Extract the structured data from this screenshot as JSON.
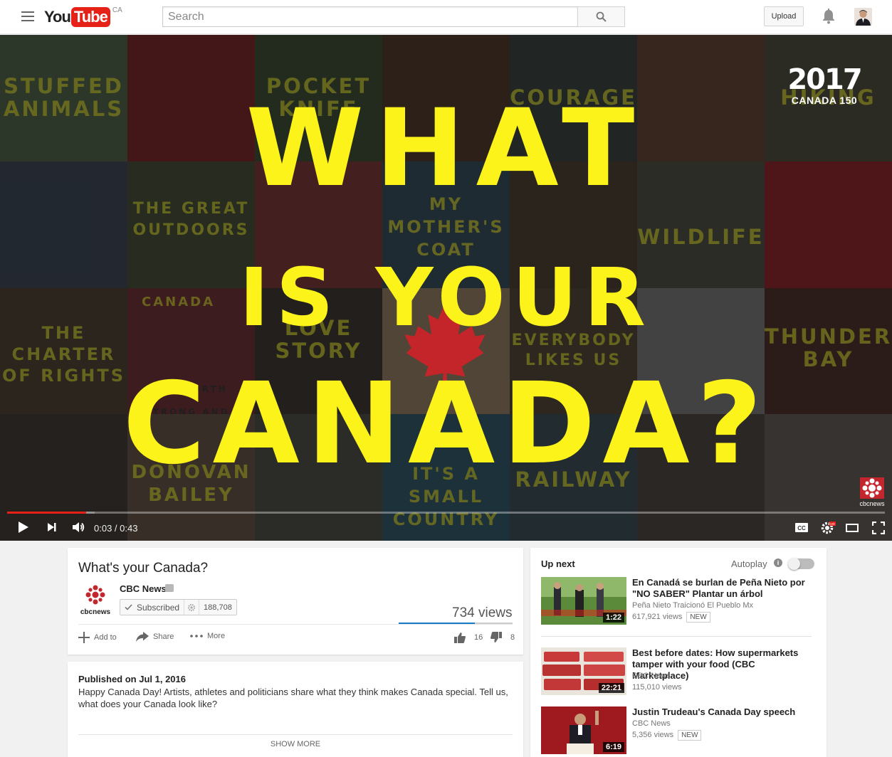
{
  "masthead": {
    "logo_you": "You",
    "logo_tube": "Tube",
    "logo_region": "CA",
    "search_placeholder": "Search",
    "upload_label": "Upload"
  },
  "player": {
    "headline_line1": "WHAT",
    "headline_line2": "IS YOUR",
    "headline_line3": "CANADA?",
    "tile_words": [
      "STUFFED ANIMALS",
      "POCKET KNIFE",
      "COURAGE",
      "HIKING",
      "THE GREAT OUTDOORS",
      "MY MOTHER'S COAT",
      "WILDLIFE",
      "THE CHARTER OF RIGHTS",
      "LOVE STORY",
      "EVERYBODY LIKES US",
      "THUNDER BAY",
      "DONOVAN BAILEY",
      "IT'S A SMALL COUNTRY",
      "RAILWAY",
      "CANADA",
      "TRUE NORTH STRONG AND FREE"
    ],
    "badge_year": "2017",
    "badge_sub": "CANADA 150",
    "watermark": "cbcnews",
    "time": "0:03 / 0:43",
    "progress_played": 0.09,
    "progress_loaded": 0.1,
    "accent": "#e62117",
    "headline_color": "#fbf31a"
  },
  "video": {
    "title": "What's your Canada?",
    "channel": "CBC News",
    "channel_logo_text": "cbcnews",
    "subscribed_label": "Subscribed",
    "subscriber_count": "188,708",
    "views": "734 views",
    "like_ratio": 0.67,
    "actions": {
      "add_to": "Add to",
      "share": "Share",
      "more": "More"
    },
    "likes": "16",
    "dislikes": "8"
  },
  "description": {
    "published": "Published on Jul 1, 2016",
    "text": "Happy Canada Day! Artists, athletes and politicians share what they think makes Canada special. Tell us, what does your Canada look like?",
    "show_more": "SHOW MORE"
  },
  "sidebar": {
    "up_next": "Up next",
    "autoplay": "Autoplay",
    "autoplay_on": false,
    "items": [
      {
        "title": "En Canadá se burlan de Peña Nieto por \"NO SABER\" Plantar un árbol",
        "channel": "Peña Nieto Traicionó El Pueblo Mx",
        "views": "617,921 views",
        "badge": "NEW",
        "duration": "1:22"
      },
      {
        "title": "Best before dates: How supermarkets tamper with your food (CBC Marketplace)",
        "channel": "CBC News",
        "views": "115,010 views",
        "badge": "",
        "duration": "22:21"
      },
      {
        "title": "Justin Trudeau's Canada Day speech",
        "channel": "CBC News",
        "views": "5,356 views",
        "badge": "NEW",
        "duration": "6:19"
      }
    ]
  }
}
